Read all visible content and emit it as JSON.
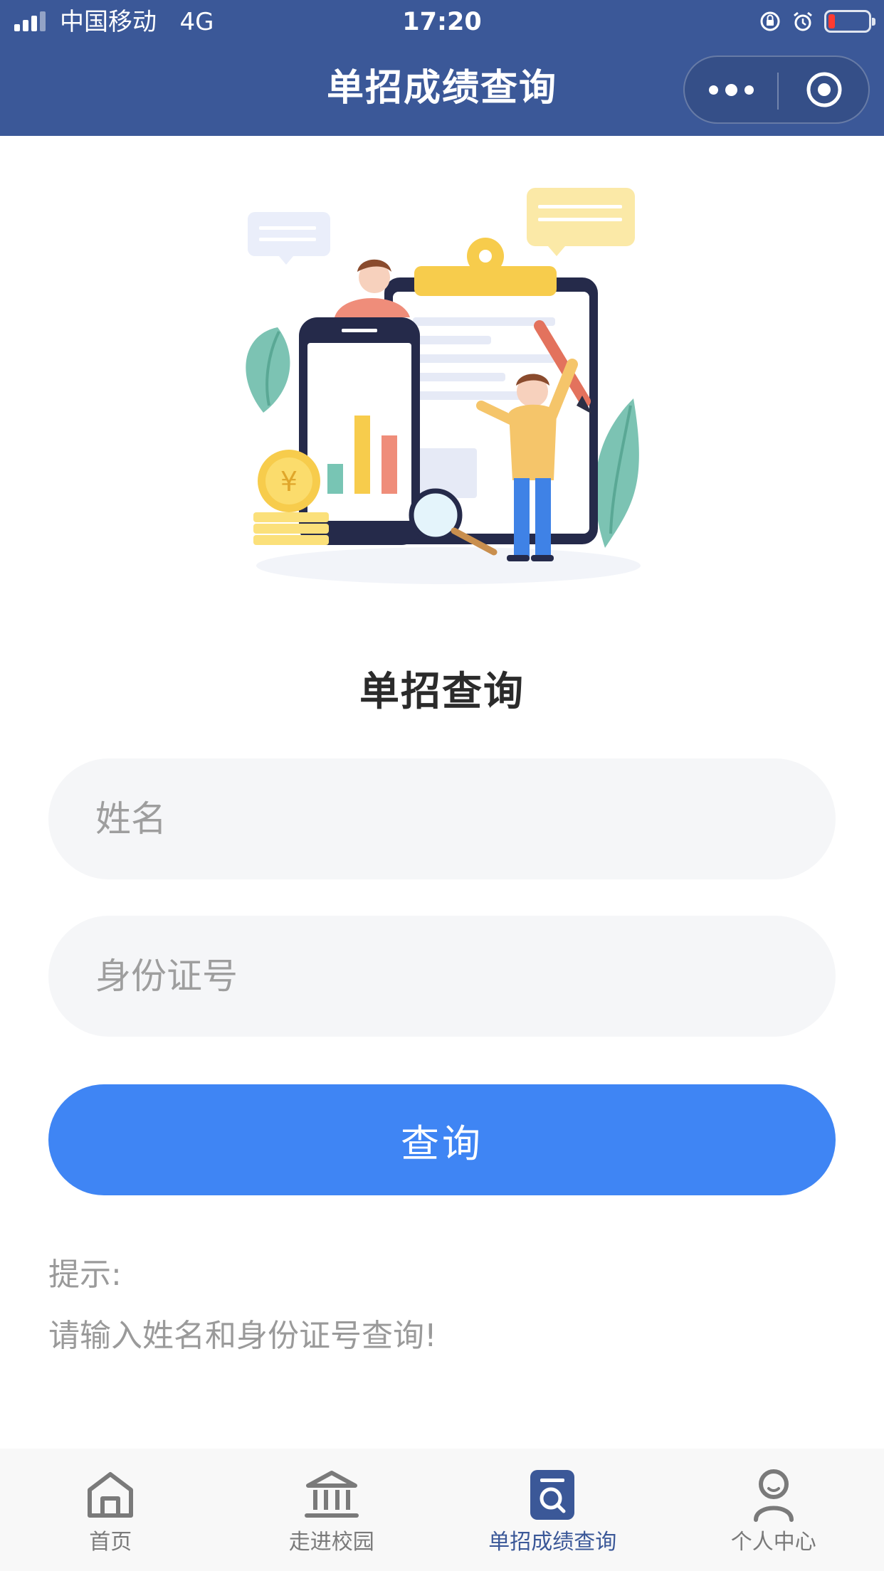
{
  "status_bar": {
    "carrier": "中国移动",
    "network": "4G",
    "time": "17:20"
  },
  "nav": {
    "title": "单招成绩查询"
  },
  "form": {
    "title": "单招查询",
    "name_placeholder": "姓名",
    "id_placeholder": "身份证号",
    "submit_label": "查询"
  },
  "tips": {
    "heading": "提示:",
    "text": "请输入姓名和身份证号查询!"
  },
  "tabbar": {
    "items": [
      {
        "label": "首页",
        "icon": "home-icon",
        "active": false
      },
      {
        "label": "走进校园",
        "icon": "campus-building-icon",
        "active": false
      },
      {
        "label": "单招成绩查询",
        "icon": "score-query-icon",
        "active": true
      },
      {
        "label": "个人中心",
        "icon": "user-icon",
        "active": false
      }
    ]
  },
  "colors": {
    "nav_bg": "#3b5898",
    "primary_button": "#3f85f4",
    "active_tab": "#3b5898",
    "field_bg": "#f5f6f8"
  }
}
